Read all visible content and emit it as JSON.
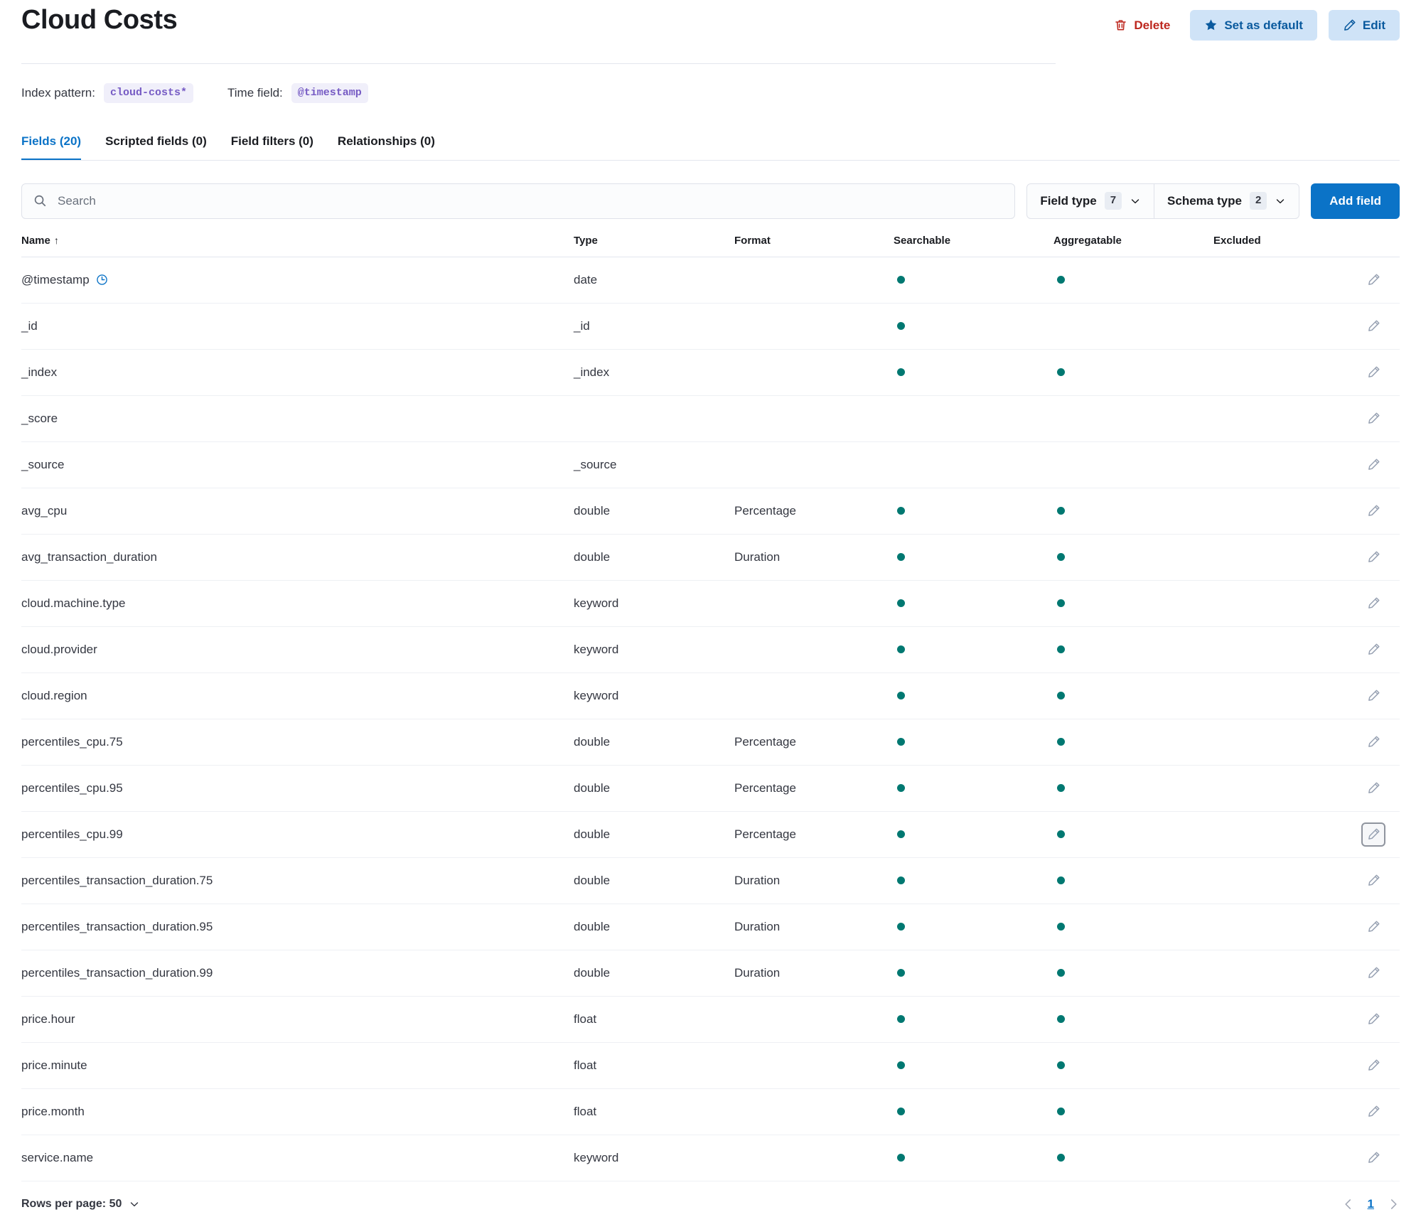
{
  "header": {
    "title": "Cloud Costs",
    "actions": [
      {
        "label": "Delete",
        "icon": "trash-icon",
        "style": "empty"
      },
      {
        "label": "Set as default",
        "icon": "star-icon",
        "style": "light"
      },
      {
        "label": "Edit",
        "icon": "pencil-icon",
        "style": "light"
      }
    ],
    "delete_color": "#bd271e",
    "accent_color": "#0b73c7"
  },
  "meta": {
    "index_pattern_label": "Index pattern:",
    "index_pattern_value": "cloud-costs*",
    "time_field_label": "Time field:",
    "time_field_value": "@timestamp",
    "badge_color": "#765bc4"
  },
  "tabs": [
    {
      "label": "Fields (20)",
      "active": true
    },
    {
      "label": "Scripted fields (0)",
      "active": false
    },
    {
      "label": "Field filters (0)",
      "active": false
    },
    {
      "label": "Relationships (0)",
      "active": false
    }
  ],
  "controls": {
    "search_placeholder": "Search",
    "search_value": "",
    "field_type": {
      "label": "Field type",
      "count": "7"
    },
    "schema_type": {
      "label": "Schema type",
      "count": "2"
    },
    "add_field_label": "Add field"
  },
  "table": {
    "columns": [
      "Name",
      "Type",
      "Format",
      "Searchable",
      "Aggregatable",
      "Excluded",
      ""
    ],
    "sort_column": "Name",
    "sort_direction": "asc",
    "rows": [
      {
        "name": "@timestamp",
        "time_icon": true,
        "type": "date",
        "format": "",
        "searchable": true,
        "aggregatable": true,
        "excluded": false,
        "edit_focused": false
      },
      {
        "name": "_id",
        "time_icon": false,
        "type": "_id",
        "format": "",
        "searchable": true,
        "aggregatable": false,
        "excluded": false,
        "edit_focused": false
      },
      {
        "name": "_index",
        "time_icon": false,
        "type": "_index",
        "format": "",
        "searchable": true,
        "aggregatable": true,
        "excluded": false,
        "edit_focused": false
      },
      {
        "name": "_score",
        "time_icon": false,
        "type": "",
        "format": "",
        "searchable": false,
        "aggregatable": false,
        "excluded": false,
        "edit_focused": false
      },
      {
        "name": "_source",
        "time_icon": false,
        "type": "_source",
        "format": "",
        "searchable": false,
        "aggregatable": false,
        "excluded": false,
        "edit_focused": false
      },
      {
        "name": "avg_cpu",
        "time_icon": false,
        "type": "double",
        "format": "Percentage",
        "searchable": true,
        "aggregatable": true,
        "excluded": false,
        "edit_focused": false
      },
      {
        "name": "avg_transaction_duration",
        "time_icon": false,
        "type": "double",
        "format": "Duration",
        "searchable": true,
        "aggregatable": true,
        "excluded": false,
        "edit_focused": false
      },
      {
        "name": "cloud.machine.type",
        "time_icon": false,
        "type": "keyword",
        "format": "",
        "searchable": true,
        "aggregatable": true,
        "excluded": false,
        "edit_focused": false
      },
      {
        "name": "cloud.provider",
        "time_icon": false,
        "type": "keyword",
        "format": "",
        "searchable": true,
        "aggregatable": true,
        "excluded": false,
        "edit_focused": false
      },
      {
        "name": "cloud.region",
        "time_icon": false,
        "type": "keyword",
        "format": "",
        "searchable": true,
        "aggregatable": true,
        "excluded": false,
        "edit_focused": false
      },
      {
        "name": "percentiles_cpu.75",
        "time_icon": false,
        "type": "double",
        "format": "Percentage",
        "searchable": true,
        "aggregatable": true,
        "excluded": false,
        "edit_focused": false
      },
      {
        "name": "percentiles_cpu.95",
        "time_icon": false,
        "type": "double",
        "format": "Percentage",
        "searchable": true,
        "aggregatable": true,
        "excluded": false,
        "edit_focused": false
      },
      {
        "name": "percentiles_cpu.99",
        "time_icon": false,
        "type": "double",
        "format": "Percentage",
        "searchable": true,
        "aggregatable": true,
        "excluded": false,
        "edit_focused": true
      },
      {
        "name": "percentiles_transaction_duration.75",
        "time_icon": false,
        "type": "double",
        "format": "Duration",
        "searchable": true,
        "aggregatable": true,
        "excluded": false,
        "edit_focused": false
      },
      {
        "name": "percentiles_transaction_duration.95",
        "time_icon": false,
        "type": "double",
        "format": "Duration",
        "searchable": true,
        "aggregatable": true,
        "excluded": false,
        "edit_focused": false
      },
      {
        "name": "percentiles_transaction_duration.99",
        "time_icon": false,
        "type": "double",
        "format": "Duration",
        "searchable": true,
        "aggregatable": true,
        "excluded": false,
        "edit_focused": false
      },
      {
        "name": "price.hour",
        "time_icon": false,
        "type": "float",
        "format": "",
        "searchable": true,
        "aggregatable": true,
        "excluded": false,
        "edit_focused": false
      },
      {
        "name": "price.minute",
        "time_icon": false,
        "type": "float",
        "format": "",
        "searchable": true,
        "aggregatable": true,
        "excluded": false,
        "edit_focused": false
      },
      {
        "name": "price.month",
        "time_icon": false,
        "type": "float",
        "format": "",
        "searchable": true,
        "aggregatable": true,
        "excluded": false,
        "edit_focused": false
      },
      {
        "name": "service.name",
        "time_icon": false,
        "type": "keyword",
        "format": "",
        "searchable": true,
        "aggregatable": true,
        "excluded": false,
        "edit_focused": false
      }
    ],
    "dot_color": "#007871"
  },
  "footer": {
    "rows_per_page_label": "Rows per page: 50",
    "current_page": "1",
    "prev_icon": "chevron-left-icon",
    "next_icon": "chevron-right-icon"
  }
}
